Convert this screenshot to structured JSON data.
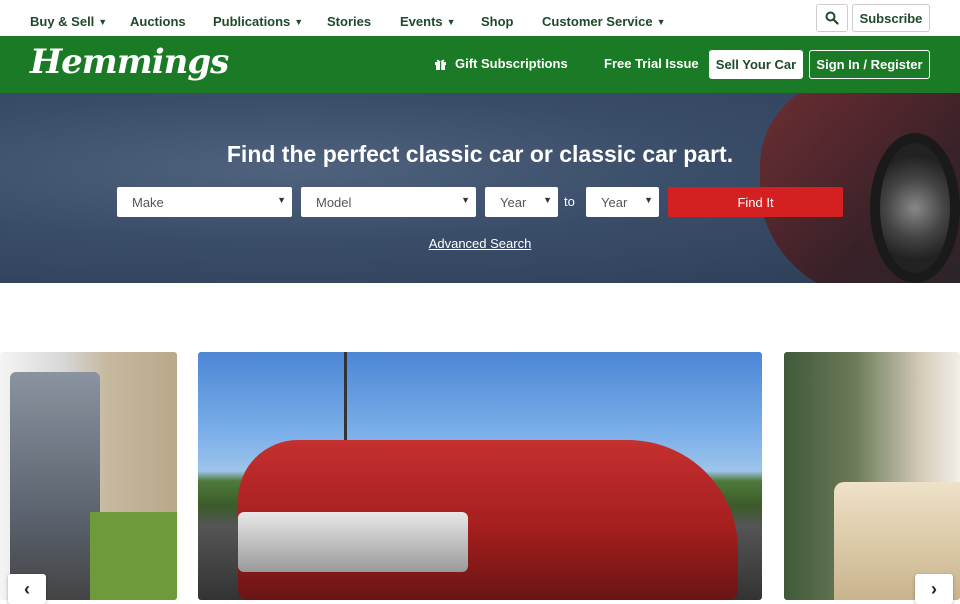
{
  "topnav": {
    "items": [
      {
        "label": "Buy & Sell",
        "has_dropdown": true
      },
      {
        "label": "Auctions",
        "has_dropdown": false
      },
      {
        "label": "Publications",
        "has_dropdown": true
      },
      {
        "label": "Stories",
        "has_dropdown": false
      },
      {
        "label": "Events",
        "has_dropdown": true
      },
      {
        "label": "Shop",
        "has_dropdown": false
      },
      {
        "label": "Customer Service",
        "has_dropdown": true
      }
    ],
    "search_icon": "search-icon",
    "subscribe_label": "Subscribe"
  },
  "header": {
    "logo_text": "Hemmings",
    "gift_icon": "gift-icon",
    "gift_label": "Gift Subscriptions",
    "trial_label": "Free Trial Issue",
    "sell_label": "Sell Your Car",
    "signin_label": "Sign In / Register",
    "brand_color": "#1a7a26"
  },
  "hero": {
    "title": "Find the perfect classic car or classic car part.",
    "make_select": "Make",
    "model_select": "Model",
    "year_from_select": "Year",
    "to_label": "to",
    "year_to_select": "Year",
    "find_label": "Find It",
    "advanced_label": "Advanced Search",
    "find_color": "#d42020"
  },
  "carousel": {
    "prev_icon": "chevron-left-icon",
    "next_icon": "chevron-right-icon"
  }
}
